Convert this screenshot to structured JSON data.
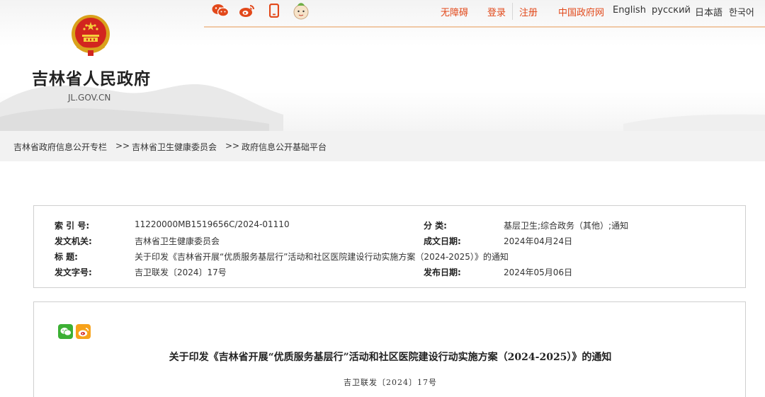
{
  "header": {
    "site_name": "吉林省人民政府",
    "site_domain": "JL.GOV.CN",
    "social_icons": [
      "wechat-icon",
      "weibo-icon",
      "mobile-icon",
      "mascot-icon"
    ],
    "links": {
      "accessibility": "无障碍",
      "login": "登录",
      "register": "注册",
      "gov_cn": "中国政府网",
      "english": "English",
      "russian": "русский",
      "japanese": "日本語",
      "korean": "한국어"
    },
    "accent_color": "#e2491b"
  },
  "breadcrumb": {
    "item1": "吉林省政府信息公开专栏",
    "sep1": ">>",
    "item2": "吉林省卫生健康委员会",
    "sep2": ">>",
    "item3": "政府信息公开基础平台"
  },
  "info": {
    "index_label": "索 引 号:",
    "index_value": "11220000MB1519656C/2024-01110",
    "category_label": "分  类:",
    "category_value": "基层卫生;综合政务（其他）;通知",
    "issuer_label": "发文机关:",
    "issuer_value": "吉林省卫生健康委员会",
    "created_label": "成文日期:",
    "created_value": "2024年04月24日",
    "title_label": "标    题:",
    "title_value": "关于印发《吉林省开展“优质服务基层行”活动和社区医院建设行动实施方案（2024-2025）》的通知",
    "docno_label": "发文字号:",
    "docno_value": "吉卫联发〔2024〕17号",
    "published_label": "发布日期:",
    "published_value": "2024年05月06日"
  },
  "article": {
    "share_icons": [
      "wechat-share-icon",
      "weibo-share-icon"
    ],
    "title": "关于印发《吉林省开展“优质服务基层行”活动和社区医院建设行动实施方案（2024-2025）》的通知",
    "doc_number": "吉卫联发〔2024〕17号"
  }
}
